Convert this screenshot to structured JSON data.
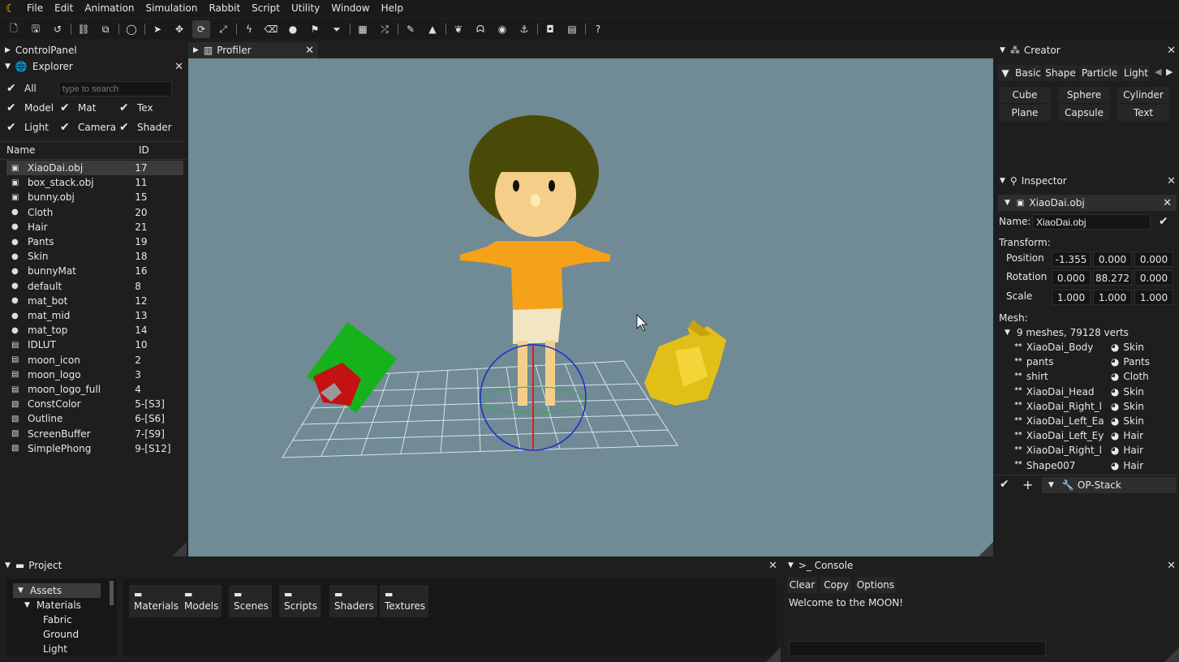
{
  "menu": [
    "File",
    "Edit",
    "Animation",
    "Simulation",
    "Rabbit",
    "Script",
    "Utility",
    "Window",
    "Help"
  ],
  "icons": {
    "app_logo": "moon-icon",
    "new": "new-file-icon",
    "save": "save-icon",
    "undo": "undo-icon",
    "link": "link-icon",
    "unlink": "unlink-icon",
    "eye": "view-icon",
    "select": "cursor-icon",
    "move": "move-icon",
    "rotate": "rotate-icon",
    "scale": "scale-icon",
    "lightning": "bolt-icon",
    "erase": "eraser-icon",
    "drop": "drop-icon",
    "flag": "flag-icon",
    "funnel": "funnel-icon",
    "grid": "grid-icon",
    "shuffle": "shuffle-icon",
    "brush": "brush-icon",
    "terrain": "terrain-icon",
    "leaf": "leaf-icon",
    "ghost": "ghost-icon",
    "ball": "ball-icon",
    "anchor": "anchor-icon",
    "camera": "camera-icon",
    "film": "film-icon",
    "help": "help-icon"
  },
  "control_panel": {
    "title": "ControlPanel"
  },
  "explorer": {
    "title": "Explorer",
    "filters": {
      "all": "All",
      "model": "Model",
      "mat": "Mat",
      "tex": "Tex",
      "light": "Light",
      "camera": "Camera",
      "shader": "Shader"
    },
    "search_placeholder": "type to search",
    "col_name": "Name",
    "col_id": "ID",
    "rows": [
      {
        "name": "XiaoDai.obj",
        "id": "17",
        "icon": "▣"
      },
      {
        "name": "box_stack.obj",
        "id": "11",
        "icon": "▣"
      },
      {
        "name": "bunny.obj",
        "id": "15",
        "icon": "▣"
      },
      {
        "name": "Cloth",
        "id": "20",
        "icon": "●"
      },
      {
        "name": "Hair",
        "id": "21",
        "icon": "●"
      },
      {
        "name": "Pants",
        "id": "19",
        "icon": "●"
      },
      {
        "name": "Skin",
        "id": "18",
        "icon": "●"
      },
      {
        "name": "bunnyMat",
        "id": "16",
        "icon": "●"
      },
      {
        "name": "default",
        "id": "8",
        "icon": "●"
      },
      {
        "name": "mat_bot",
        "id": "12",
        "icon": "●"
      },
      {
        "name": "mat_mid",
        "id": "13",
        "icon": "●"
      },
      {
        "name": "mat_top",
        "id": "14",
        "icon": "●"
      },
      {
        "name": "IDLUT",
        "id": "10",
        "icon": "▤"
      },
      {
        "name": "moon_icon",
        "id": "2",
        "icon": "▤"
      },
      {
        "name": "moon_logo",
        "id": "3",
        "icon": "▤"
      },
      {
        "name": "moon_logo_full",
        "id": "4",
        "icon": "▤"
      },
      {
        "name": "ConstColor",
        "id": "5-[S3]",
        "icon": "▧"
      },
      {
        "name": "Outline",
        "id": "6-[S6]",
        "icon": "▧"
      },
      {
        "name": "ScreenBuffer",
        "id": "7-[S9]",
        "icon": "▧"
      },
      {
        "name": "SimplePhong",
        "id": "9-[S12]",
        "icon": "▧"
      }
    ]
  },
  "profiler": {
    "title": "Profiler"
  },
  "creator": {
    "title": "Creator",
    "tabs": [
      "Basic",
      "Shape",
      "Particle",
      "Light"
    ],
    "buttons": [
      "Cube",
      "Sphere",
      "Cylinder",
      "Plane",
      "Capsule",
      "Text"
    ]
  },
  "inspector": {
    "title": "Inspector",
    "object": "XiaoDai.obj",
    "name_label": "Name:",
    "name_value": "XiaoDai.obj",
    "transform_label": "Transform:",
    "position_label": "Position",
    "rotation_label": "Rotation",
    "scale_label": "Scale",
    "position": [
      "-1.355",
      "0.000",
      "0.000"
    ],
    "rotation": [
      "0.000",
      "88.272",
      "0.000"
    ],
    "scale": [
      "1.000",
      "1.000",
      "1.000"
    ],
    "mesh_label": "Mesh:",
    "mesh_summary": "9 meshes, 79128 verts",
    "meshes": [
      {
        "name": "XiaoDai_Body",
        "mat": "Skin"
      },
      {
        "name": "pants",
        "mat": "Pants"
      },
      {
        "name": "shirt",
        "mat": "Cloth"
      },
      {
        "name": "XiaoDai_Head",
        "mat": "Skin"
      },
      {
        "name": "XiaoDai_Right_l",
        "mat": "Skin"
      },
      {
        "name": "XiaoDai_Left_Ea",
        "mat": "Skin"
      },
      {
        "name": "XiaoDai_Left_Ey",
        "mat": "Hair"
      },
      {
        "name": "XiaoDai_Right_l",
        "mat": "Hair"
      },
      {
        "name": "Shape007",
        "mat": "Hair"
      }
    ],
    "op_stack": "OP-Stack"
  },
  "project": {
    "title": "Project",
    "tree": {
      "root": "Assets",
      "child": "Materials",
      "items": [
        "Fabric",
        "Ground",
        "Light"
      ]
    },
    "folders": [
      "Materials",
      "Models",
      "Scenes",
      "Scripts",
      "Shaders",
      "Textures"
    ]
  },
  "console": {
    "title": ">_ Console",
    "buttons": [
      "Clear",
      "Copy",
      "Options"
    ],
    "message": "Welcome to the MOON!"
  },
  "colors": {
    "bg": "#1e1e1e",
    "viewport": "#708a96",
    "accent": "#f3c425"
  }
}
